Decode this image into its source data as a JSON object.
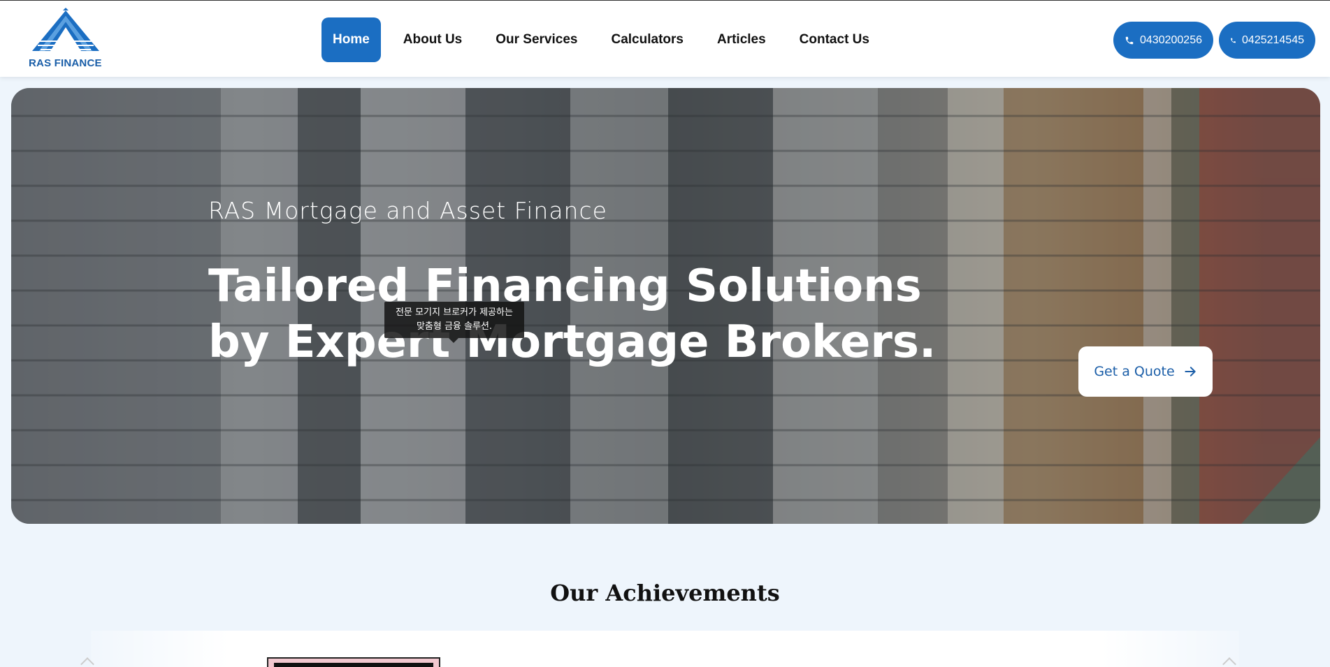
{
  "header": {
    "logo_text": "RAS FINANCE",
    "nav": [
      {
        "label": "Home",
        "active": true
      },
      {
        "label": "About Us"
      },
      {
        "label": "Our Services"
      },
      {
        "label": "Calculators"
      },
      {
        "label": "Articles"
      },
      {
        "label": "Contact Us"
      }
    ],
    "phones": [
      "0430200256",
      "0425214545"
    ],
    "icons": {
      "phone": "phone-icon"
    }
  },
  "hero": {
    "subtitle": "RAS Mortgage and Asset Finance",
    "title": "Tailored Financing Solutions by Expert Mortgage Brokers.",
    "tooltip_line1": "전문 모기지 브로커가 제공하는",
    "tooltip_line2": "맞춤형 금융 솔루션.",
    "cta_label": "Get a Quote",
    "cta_icon": "arrow-right-icon"
  },
  "achievements": {
    "title": "Our Achievements"
  },
  "colors": {
    "brand_blue": "#1b6ec2",
    "page_background": "#eef5fc"
  }
}
